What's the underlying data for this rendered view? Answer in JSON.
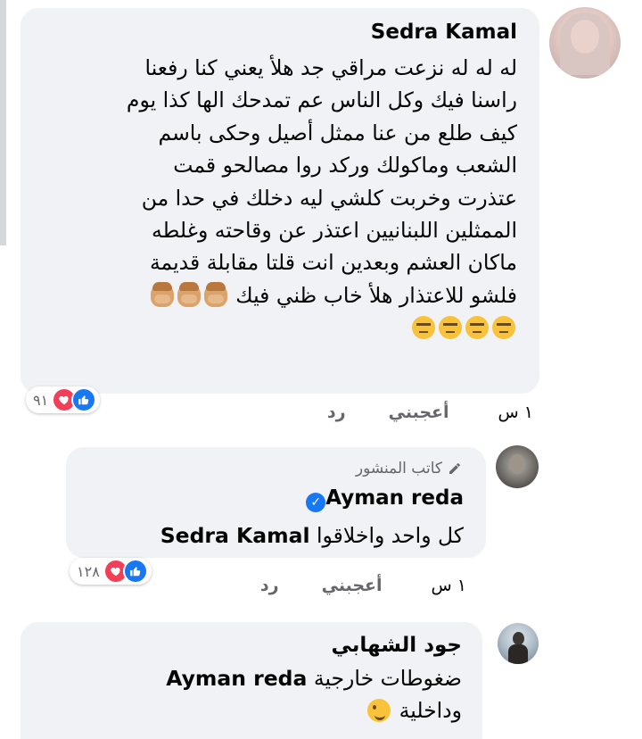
{
  "comments": [
    {
      "author": "Sedra Kamal",
      "lines": [
        "له له له نزعت مراقي جد هلأ يعني كنا رفعنا",
        "راسنا فيك وكل الناس عم تمدحك الها كذا يوم",
        "كيف طلع من عنا ممثل أصيل وحكى باسم",
        "الشعب وماكولك وركد روا مصالحو قمت",
        "عتذرت وخربت كلشي ليه دخلك في حدا من",
        "الممثلين اللبنانيين اعتذر عن وقاحته وغلطه",
        "ماكان العشم وبعدين انت قلتا مقابلة قديمة",
        "فلشو للاعتذار هلأ خاب ظني فيك"
      ],
      "emoji_line_1": [
        "face-palm-emoji",
        "face-palm-emoji",
        "face-palm-emoji"
      ],
      "emoji_line_2": [
        "unamused-face-emoji",
        "unamused-face-emoji",
        "unamused-face-emoji",
        "unamused-face-emoji"
      ],
      "reaction_count": "٩١",
      "time": "١ س",
      "like_label": "أعجبني",
      "reply_label": "رد"
    },
    {
      "author_badge": "كاتب المنشور",
      "author": "Ayman reda",
      "verified": true,
      "text": "كل واحد واخلاقوا",
      "mention": "Sedra Kamal",
      "reaction_count": "١٢٨",
      "time": "١ س",
      "like_label": "أعجبني",
      "reply_label": "رد"
    },
    {
      "author": "جود الشهابي",
      "text_line_1": "ضغوطات خارجية",
      "mention": "Ayman reda",
      "text_line_2": "وداخلية",
      "emoji": "winking-face-emoji"
    }
  ],
  "colors": {
    "bubble": "#f0f2f5",
    "like_blue": "#1877f2",
    "love_red": "#f33e58",
    "meta_gray": "#65676b"
  }
}
